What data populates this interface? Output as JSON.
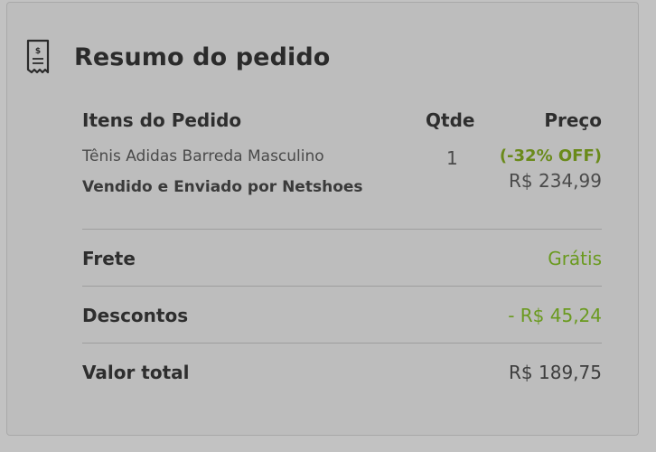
{
  "summary": {
    "icon": "receipt-icon",
    "title": "Resumo do pedido",
    "columns": {
      "items": "Itens do Pedido",
      "qty": "Qtde",
      "price": "Preço"
    },
    "item": {
      "name": "Tênis Adidas Barreda Masculino",
      "seller": "Vendido e Enviado por Netshoes",
      "qty": "1",
      "discount": "(-32% OFF)",
      "price": "R$ 234,99"
    },
    "shipping": {
      "label": "Frete",
      "value": "Grátis"
    },
    "discounts": {
      "label": "Descontos",
      "value": "- R$ 45,24"
    },
    "total": {
      "label": "Valor total",
      "value": "R$ 189,75"
    }
  },
  "colors": {
    "accent_green": "#6a9a1f",
    "background": "#c2c2c2",
    "text": "#2e2e2e"
  }
}
